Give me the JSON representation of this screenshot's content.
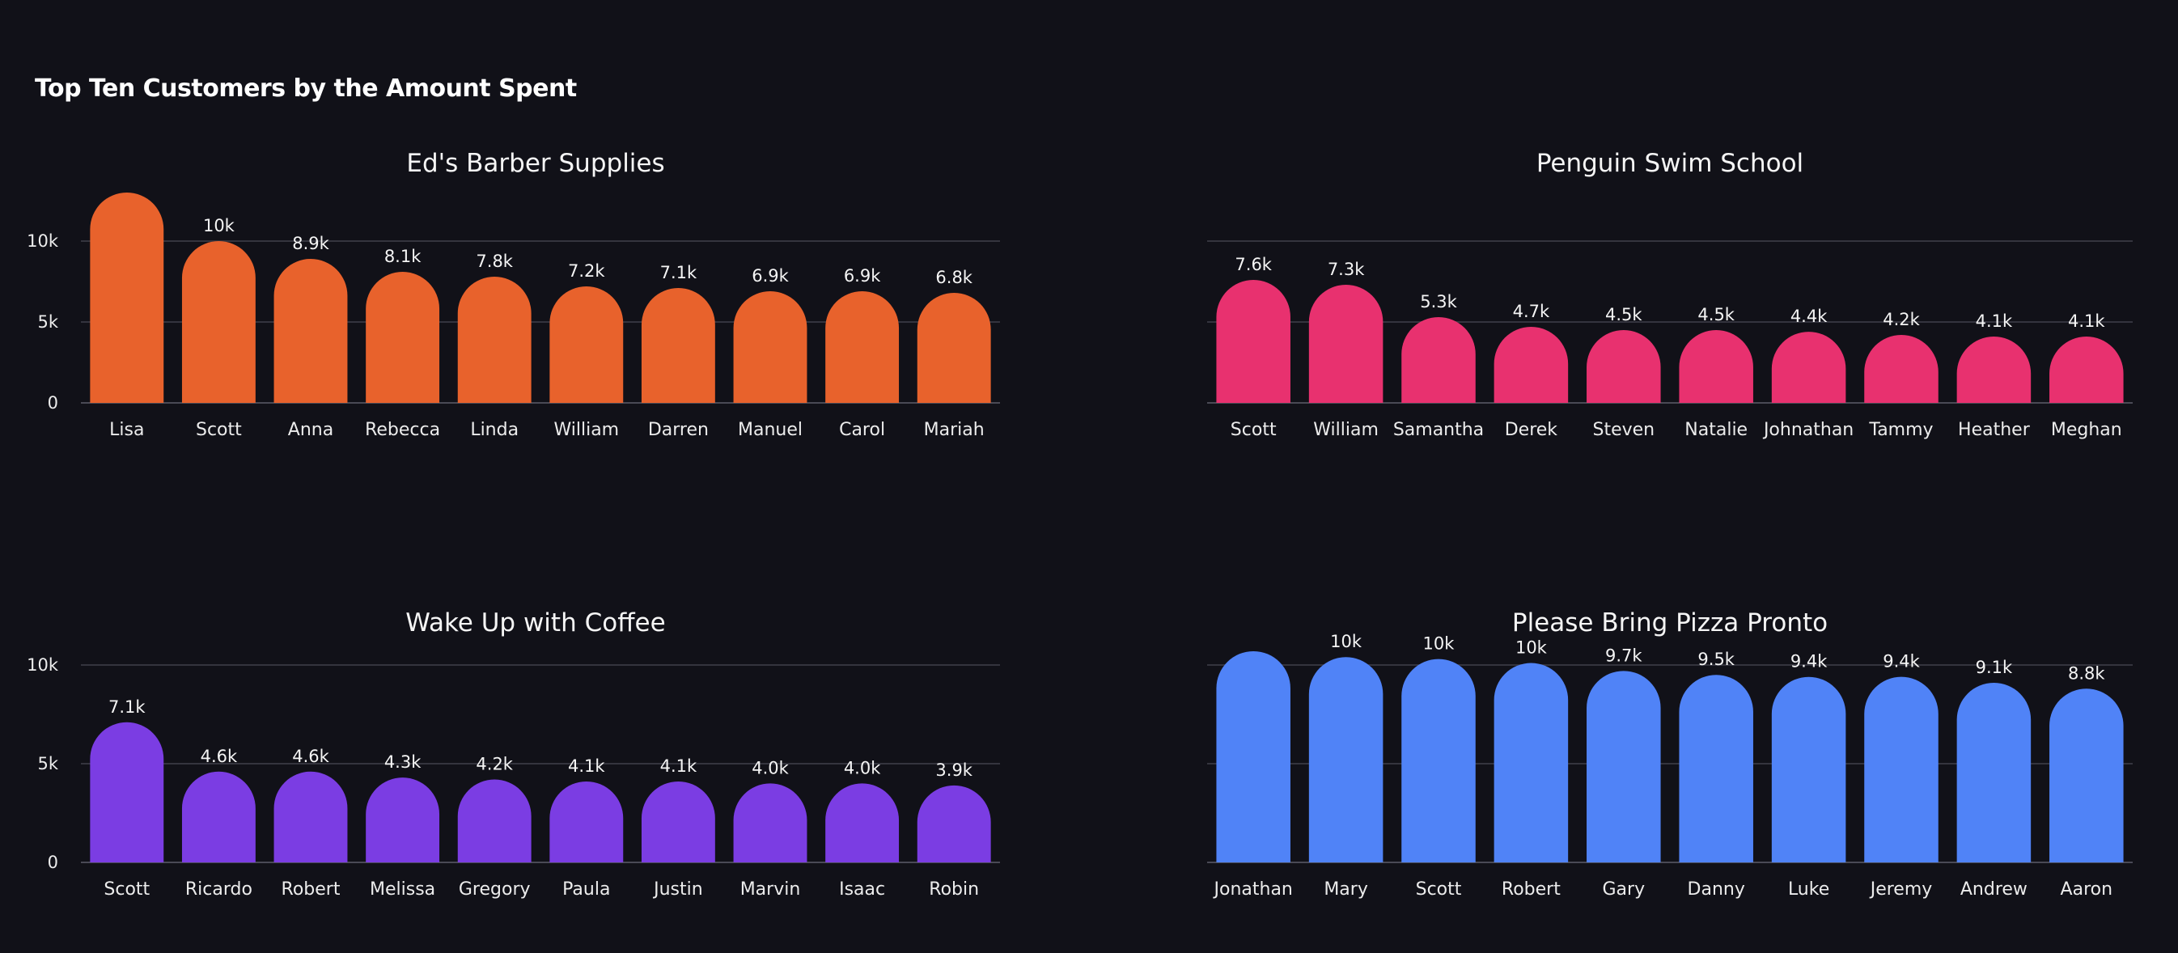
{
  "page": {
    "title": "Top Ten Customers by the Amount Spent"
  },
  "chart_data": [
    {
      "type": "bar",
      "title": "Ed's Barber Supplies",
      "color": "#e8622c",
      "categories": [
        "Lisa",
        "Scott",
        "Anna",
        "Rebecca",
        "Linda",
        "William",
        "Darren",
        "Manuel",
        "Carol",
        "Mariah"
      ],
      "values": [
        13000,
        10000,
        8900,
        8100,
        7800,
        7200,
        7100,
        6900,
        6900,
        6800
      ],
      "labels": [
        "",
        "10k",
        "8.9k",
        "8.1k",
        "7.8k",
        "7.2k",
        "7.1k",
        "6.9k",
        "6.9k",
        "6.8k"
      ],
      "ylim": [
        0,
        12000
      ],
      "yticks": [
        0,
        5000,
        10000
      ],
      "ytick_labels": [
        "0",
        "5k",
        "10k"
      ],
      "show_yaxis": true,
      "grid": true
    },
    {
      "type": "bar",
      "title": "Penguin Swim School",
      "color": "#e8316f",
      "categories": [
        "Scott",
        "William",
        "Samantha",
        "Derek",
        "Steven",
        "Natalie",
        "Johnathan",
        "Tammy",
        "Heather",
        "Meghan"
      ],
      "values": [
        7600,
        7300,
        5300,
        4700,
        4500,
        4500,
        4400,
        4200,
        4100,
        4100
      ],
      "labels": [
        "7.6k",
        "7.3k",
        "5.3k",
        "4.7k",
        "4.5k",
        "4.5k",
        "4.4k",
        "4.2k",
        "4.1k",
        "4.1k"
      ],
      "ylim": [
        0,
        10000
      ],
      "yticks": [
        0,
        5000,
        10000
      ],
      "ytick_labels": [
        "",
        "",
        ""
      ],
      "show_yaxis": false,
      "grid": true
    },
    {
      "type": "bar",
      "title": "Wake Up with Coffee",
      "color": "#7b3de3",
      "categories": [
        "Scott",
        "Ricardo",
        "Robert",
        "Melissa",
        "Gregory",
        "Paula",
        "Justin",
        "Marvin",
        "Isaac",
        "Robin"
      ],
      "values": [
        7100,
        4600,
        4600,
        4300,
        4200,
        4100,
        4100,
        4000,
        4000,
        3900
      ],
      "labels": [
        "7.1k",
        "4.6k",
        "4.6k",
        "4.3k",
        "4.2k",
        "4.1k",
        "4.1k",
        "4.0k",
        "4.0k",
        "3.9k"
      ],
      "ylim": [
        0,
        10000
      ],
      "yticks": [
        0,
        5000,
        10000
      ],
      "ytick_labels": [
        "0",
        "5k",
        "10k"
      ],
      "show_yaxis": true,
      "grid": true
    },
    {
      "type": "bar",
      "title": "Please Bring Pizza Pronto",
      "color": "#5083f7",
      "categories": [
        "Jonathan",
        "Mary",
        "Scott",
        "Robert",
        "Gary",
        "Danny",
        "Luke",
        "Jeremy",
        "Andrew",
        "Aaron"
      ],
      "values": [
        10700,
        10400,
        10300,
        10100,
        9700,
        9500,
        9400,
        9400,
        9100,
        8800
      ],
      "labels": [
        "",
        "10k",
        "10k",
        "10k",
        "9.7k",
        "9.5k",
        "9.4k",
        "9.4k",
        "9.1k",
        "8.8k"
      ],
      "ylim": [
        0,
        10000
      ],
      "yticks": [
        0,
        5000,
        10000
      ],
      "ytick_labels": [
        "",
        "",
        ""
      ],
      "show_yaxis": false,
      "grid": true
    }
  ]
}
